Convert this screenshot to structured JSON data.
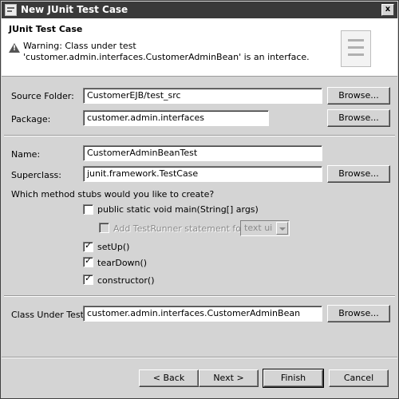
{
  "window": {
    "title": "New JUnit Test Case",
    "close_glyph": "x"
  },
  "banner": {
    "heading": "JUnit Test Case",
    "warning": "Warning: Class under test 'customer.admin.interfaces.CustomerAdminBean' is an interface.",
    "warning_icon": "warning-icon",
    "wizard_icon": "junit-wizard-icon"
  },
  "form": {
    "source_folder": {
      "label": "Source Folder:",
      "value": "CustomerEJB/test_src",
      "browse": "Browse..."
    },
    "package": {
      "label": "Package:",
      "value": "customer.admin.interfaces",
      "browse": "Browse..."
    },
    "name": {
      "label": "Name:",
      "value": "CustomerAdminBeanTest"
    },
    "superclass": {
      "label": "Superclass:",
      "value": "junit.framework.TestCase",
      "browse": "Browse..."
    },
    "stubs_question": "Which method stubs would you like to create?",
    "stubs": {
      "main": {
        "label": "public static void main(String[] args)",
        "checked": false
      },
      "testrunner": {
        "label": "Add TestRunner statement for:",
        "checked": false,
        "enabled": false,
        "combo_value": "text ui"
      },
      "setup": {
        "label": "setUp()",
        "checked": true
      },
      "teardown": {
        "label": "tearDown()",
        "checked": true
      },
      "constructor": {
        "label": "constructor()",
        "checked": true
      }
    },
    "class_under_test": {
      "label": "Class Under Test:",
      "value": "customer.admin.interfaces.CustomerAdminBean",
      "browse": "Browse..."
    }
  },
  "buttons": {
    "back": "< Back",
    "next": "Next >",
    "finish": "Finish",
    "cancel": "Cancel"
  }
}
